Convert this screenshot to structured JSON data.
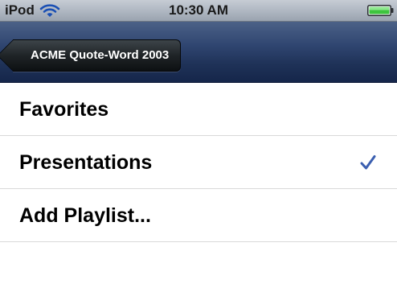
{
  "status_bar": {
    "carrier": "iPod",
    "time": "10:30 AM",
    "wifi_icon": "wifi-icon",
    "battery_icon": "battery-full-icon",
    "battery_color": "#3ec43e"
  },
  "nav_bar": {
    "back_label": "ACME Quote-Word 2003",
    "back_icon": "back-arrow-icon"
  },
  "list": {
    "items": [
      {
        "label": "Favorites",
        "checked": false
      },
      {
        "label": "Presentations",
        "checked": true
      },
      {
        "label": "Add Playlist...",
        "checked": false
      }
    ],
    "check_icon": "checkmark-icon",
    "check_color": "#3b5fb0"
  }
}
